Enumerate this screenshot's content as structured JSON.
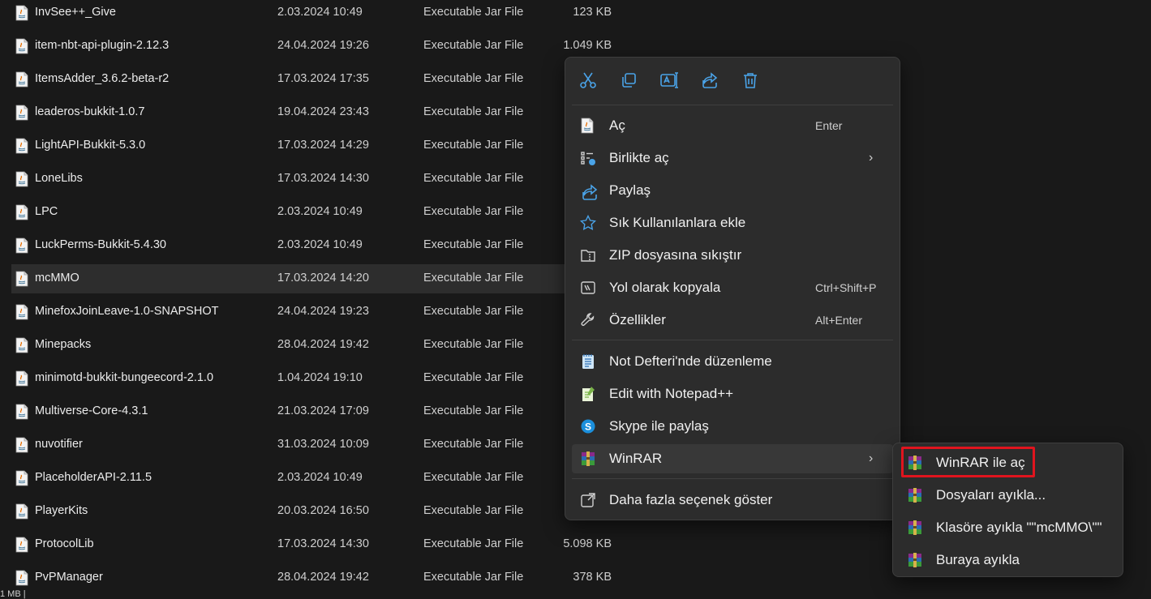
{
  "files": [
    {
      "name": "InvSee++_Give",
      "date": "2.03.2024 10:49",
      "type": "Executable Jar File",
      "size": "123 KB"
    },
    {
      "name": "item-nbt-api-plugin-2.12.3",
      "date": "24.04.2024 19:26",
      "type": "Executable Jar File",
      "size": "1.049 KB"
    },
    {
      "name": "ItemsAdder_3.6.2-beta-r2",
      "date": "17.03.2024 17:35",
      "type": "Executable Jar File",
      "size": ""
    },
    {
      "name": "leaderos-bukkit-1.0.7",
      "date": "19.04.2024 23:43",
      "type": "Executable Jar File",
      "size": ""
    },
    {
      "name": "LightAPI-Bukkit-5.3.0",
      "date": "17.03.2024 14:29",
      "type": "Executable Jar File",
      "size": ""
    },
    {
      "name": "LoneLibs",
      "date": "17.03.2024 14:30",
      "type": "Executable Jar File",
      "size": ""
    },
    {
      "name": "LPC",
      "date": "2.03.2024 10:49",
      "type": "Executable Jar File",
      "size": ""
    },
    {
      "name": "LuckPerms-Bukkit-5.4.30",
      "date": "2.03.2024 10:49",
      "type": "Executable Jar File",
      "size": ""
    },
    {
      "name": "mcMMO",
      "date": "17.03.2024 14:20",
      "type": "Executable Jar File",
      "size": "",
      "selected": true
    },
    {
      "name": "MinefoxJoinLeave-1.0-SNAPSHOT",
      "date": "24.04.2024 19:23",
      "type": "Executable Jar File",
      "size": ""
    },
    {
      "name": "Minepacks",
      "date": "28.04.2024 19:42",
      "type": "Executable Jar File",
      "size": ""
    },
    {
      "name": "minimotd-bukkit-bungeecord-2.1.0",
      "date": "1.04.2024 19:10",
      "type": "Executable Jar File",
      "size": ""
    },
    {
      "name": "Multiverse-Core-4.3.1",
      "date": "21.03.2024 17:09",
      "type": "Executable Jar File",
      "size": ""
    },
    {
      "name": "nuvotifier",
      "date": "31.03.2024 10:09",
      "type": "Executable Jar File",
      "size": ""
    },
    {
      "name": "PlaceholderAPI-2.11.5",
      "date": "2.03.2024 10:49",
      "type": "Executable Jar File",
      "size": ""
    },
    {
      "name": "PlayerKits",
      "date": "20.03.2024 16:50",
      "type": "Executable Jar File",
      "size": ""
    },
    {
      "name": "ProtocolLib",
      "date": "17.03.2024 14:30",
      "type": "Executable Jar File",
      "size": "5.098 KB"
    },
    {
      "name": "PvPManager",
      "date": "28.04.2024 19:42",
      "type": "Executable Jar File",
      "size": "378 KB"
    }
  ],
  "status": {
    "text": "1 MB  |"
  },
  "context_menu": {
    "toolbar": [
      {
        "icon": "scissors-icon",
        "name": "cut-button"
      },
      {
        "icon": "copy-icon",
        "name": "copy-button"
      },
      {
        "icon": "rename-icon",
        "name": "rename-button"
      },
      {
        "icon": "share-icon",
        "name": "share-button"
      },
      {
        "icon": "trash-icon",
        "name": "delete-button"
      }
    ],
    "items": [
      {
        "label": "Aç",
        "shortcut": "Enter",
        "icon": "java-icon"
      },
      {
        "label": "Birlikte aç",
        "shortcut": "",
        "icon": "open-with-icon",
        "submenu": true
      },
      {
        "label": "Paylaş",
        "shortcut": "",
        "icon": "share-icon"
      },
      {
        "label": "Sık Kullanılanlara ekle",
        "shortcut": "",
        "icon": "star-icon"
      },
      {
        "label": "ZIP dosyasına sıkıştır",
        "shortcut": "",
        "icon": "zip-folder-icon"
      },
      {
        "label": "Yol olarak kopyala",
        "shortcut": "Ctrl+Shift+P",
        "icon": "copy-path-icon"
      },
      {
        "label": "Özellikler",
        "shortcut": "Alt+Enter",
        "icon": "wrench-icon"
      },
      {
        "label": "Not Defteri'nde düzenleme",
        "shortcut": "",
        "icon": "notepad-icon"
      },
      {
        "label": "Edit with Notepad++",
        "shortcut": "",
        "icon": "notepadpp-icon"
      },
      {
        "label": "Skype ile paylaş",
        "shortcut": "",
        "icon": "skype-icon"
      },
      {
        "label": "WinRAR",
        "shortcut": "",
        "icon": "winrar-icon",
        "submenu": true,
        "highlighted": true
      },
      {
        "label": "Daha fazla seçenek göster",
        "shortcut": "",
        "icon": "more-options-icon"
      }
    ]
  },
  "winrar_submenu": {
    "items": [
      {
        "label": "WinRAR ile aç",
        "icon": "winrar-icon",
        "outlined": true
      },
      {
        "label": "Dosyaları ayıkla...",
        "icon": "winrar-icon"
      },
      {
        "label": "Klasöre ayıkla \"\"mcMMO\\\"\"",
        "icon": "winrar-icon"
      },
      {
        "label": "Buraya ayıkla",
        "icon": "winrar-icon"
      }
    ]
  },
  "colors": {
    "background": "#191919",
    "menu": "#2c2c2c",
    "selection": "#2d2d2d",
    "outline": "#e0141e",
    "accent": "#4aa3e8"
  }
}
